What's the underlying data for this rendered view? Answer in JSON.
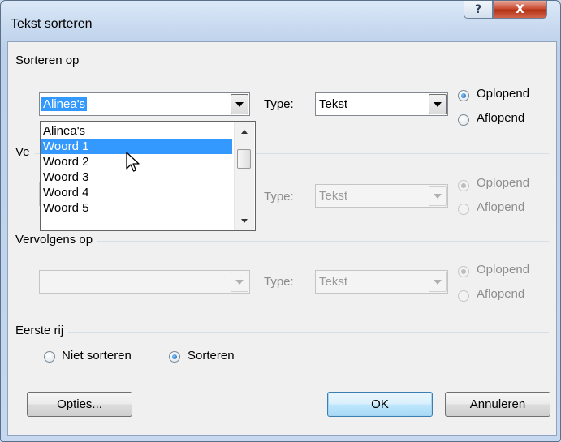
{
  "window": {
    "title": "Tekst sorteren",
    "help_glyph": "?",
    "close_glyph": "X"
  },
  "group1": {
    "label": "Sorteren op",
    "combo_value": "Alinea's",
    "type_label": "Type:",
    "type_value": "Tekst",
    "ascending": "Oplopend",
    "descending": "Aflopend",
    "selected": "ascending"
  },
  "group2": {
    "label": "Ve",
    "type_label": "Type:",
    "type_value": "Tekst",
    "ascending": "Oplopend",
    "descending": "Aflopend",
    "enabled": false
  },
  "group3": {
    "label": "Vervolgens op",
    "combo_value": "",
    "type_label": "Type:",
    "type_value": "Tekst",
    "ascending": "Oplopend",
    "descending": "Aflopend",
    "enabled": false
  },
  "first_row": {
    "label": "Eerste rij",
    "no_sort": "Niet sorteren",
    "sort": "Sorteren",
    "selected": "sort"
  },
  "dropdown": {
    "items": [
      "Alinea's",
      "Woord 1",
      "Woord 2",
      "Woord 3",
      "Woord 4",
      "Woord 5"
    ],
    "highlighted": "Woord 1"
  },
  "buttons": {
    "options": "Opties...",
    "ok": "OK",
    "cancel": "Annuleren"
  },
  "icons": {
    "help": "help-icon",
    "close": "close-icon",
    "dropdown_arrow": "chevron-down-icon",
    "cursor": "mouse-pointer-icon"
  }
}
